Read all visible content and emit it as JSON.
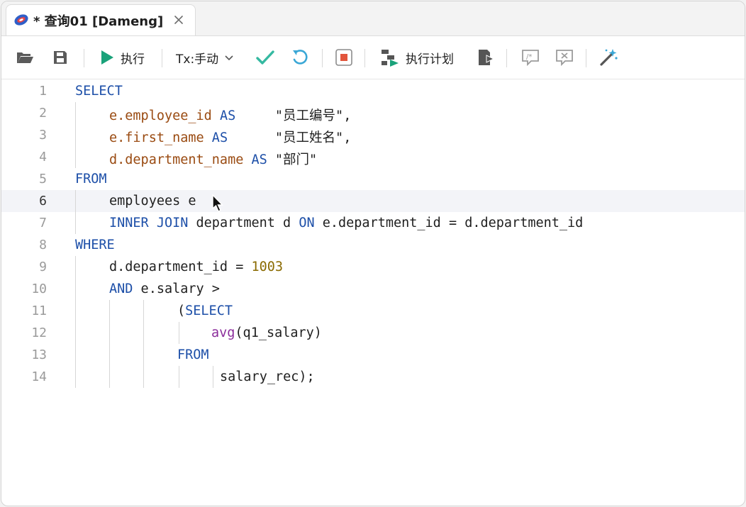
{
  "tab": {
    "icon": "database-icon",
    "title": "* 查询01 [Dameng]",
    "close_icon": "close-icon"
  },
  "toolbar": {
    "open": "folder-open-icon",
    "save": "save-icon",
    "run_label": "执行",
    "tx_label": "Tx:手动",
    "plan_label": "执行计划",
    "colors": {
      "run": "#1aa27a",
      "commit": "#35b9a1",
      "rollback": "#3aa7d6",
      "stop": "#e2553c"
    }
  },
  "editor": {
    "current_line": 6,
    "lines": [
      {
        "n": "1",
        "indent": 0,
        "tokens": [
          {
            "t": "SELECT",
            "c": "kw"
          }
        ]
      },
      {
        "n": "2",
        "indent": 1,
        "tokens": [
          {
            "t": "e.",
            "c": "fld"
          },
          {
            "t": "employee_id",
            "c": "fld"
          },
          {
            "t": " AS",
            "c": "kw"
          },
          {
            "t": "     \"员工编号\",",
            "c": "str"
          }
        ]
      },
      {
        "n": "3",
        "indent": 1,
        "tokens": [
          {
            "t": "e.",
            "c": "fld"
          },
          {
            "t": "first_name",
            "c": "fld"
          },
          {
            "t": " AS",
            "c": "kw"
          },
          {
            "t": "      \"员工姓名\",",
            "c": "str"
          }
        ]
      },
      {
        "n": "4",
        "indent": 1,
        "tokens": [
          {
            "t": "d.",
            "c": "fld"
          },
          {
            "t": "department_name",
            "c": "fld"
          },
          {
            "t": " AS",
            "c": "kw"
          },
          {
            "t": " \"部门\"",
            "c": "str"
          }
        ]
      },
      {
        "n": "5",
        "indent": 0,
        "tokens": [
          {
            "t": "FROM",
            "c": "kw"
          }
        ]
      },
      {
        "n": "6",
        "indent": 1,
        "tokens": [
          {
            "t": "employees e",
            "c": "plain"
          }
        ]
      },
      {
        "n": "7",
        "indent": 1,
        "tokens": [
          {
            "t": "INNER JOIN",
            "c": "kw"
          },
          {
            "t": " department d ",
            "c": "plain"
          },
          {
            "t": "ON",
            "c": "kw"
          },
          {
            "t": " e.department_id = d.department_id",
            "c": "plain"
          }
        ]
      },
      {
        "n": "8",
        "indent": 0,
        "tokens": [
          {
            "t": "WHERE",
            "c": "kw"
          }
        ]
      },
      {
        "n": "9",
        "indent": 1,
        "tokens": [
          {
            "t": "d.department_id = ",
            "c": "plain"
          },
          {
            "t": "1003",
            "c": "num"
          }
        ]
      },
      {
        "n": "10",
        "indent": 1,
        "tokens": [
          {
            "t": "AND",
            "c": "kw"
          },
          {
            "t": " e.salary >",
            "c": "plain"
          }
        ]
      },
      {
        "n": "11",
        "indent": 3,
        "tokens": [
          {
            "t": "(",
            "c": "plain"
          },
          {
            "t": "SELECT",
            "c": "kw"
          }
        ]
      },
      {
        "n": "12",
        "indent": 4,
        "tokens": [
          {
            "t": "avg",
            "c": "fn"
          },
          {
            "t": "(q1_salary)",
            "c": "plain"
          }
        ]
      },
      {
        "n": "13",
        "indent": 3,
        "tokens": [
          {
            "t": "FROM",
            "c": "kw"
          }
        ]
      },
      {
        "n": "14",
        "indent": 4.25,
        "tokens": [
          {
            "t": "salary_rec);",
            "c": "plain"
          }
        ]
      }
    ]
  }
}
